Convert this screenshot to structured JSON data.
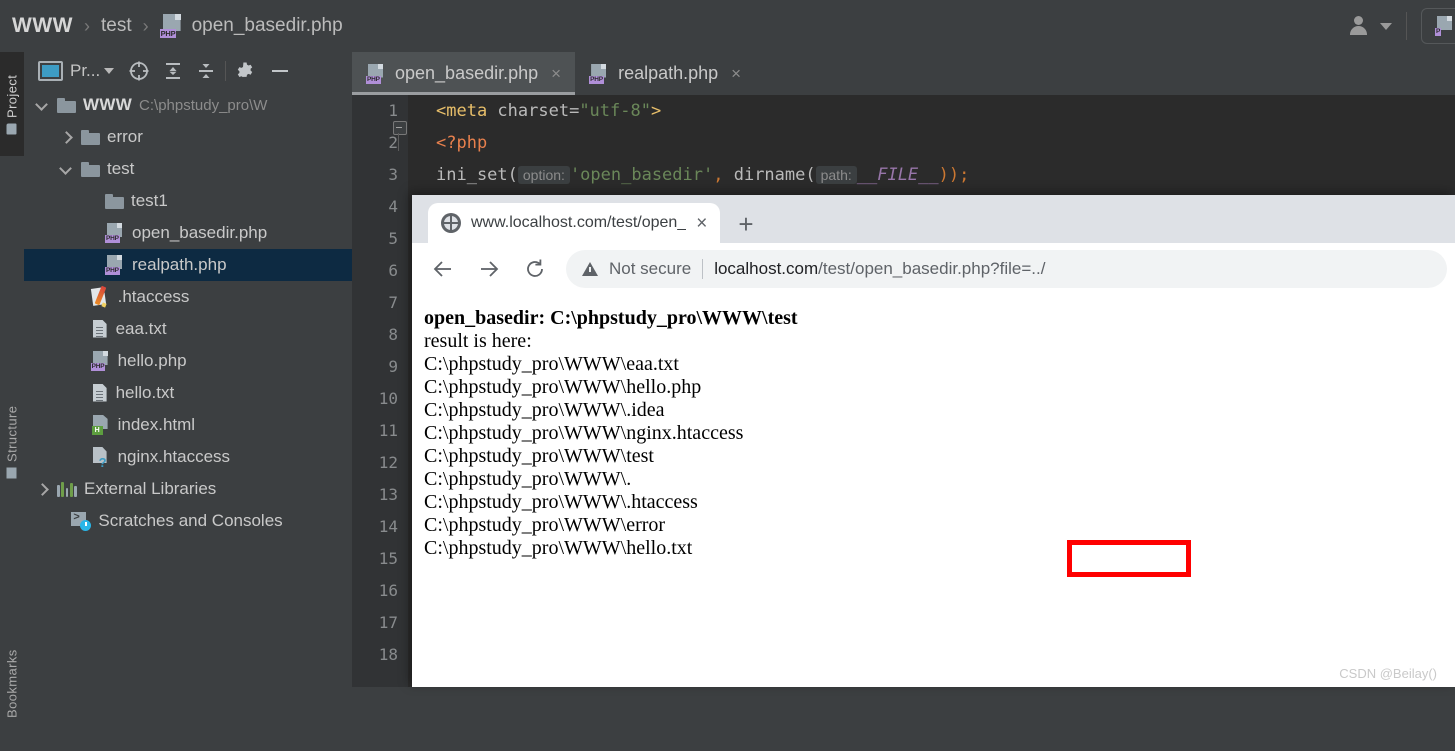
{
  "breadcrumb": {
    "root": "WWW",
    "sep": "›",
    "folder": "test",
    "file": "open_basedir.php",
    "file_icon": "php-file-icon"
  },
  "topbar": {
    "account_icon": "user-account-icon",
    "account_caret": "chevron-down-icon",
    "run_config_icon": "php-run-config-icon"
  },
  "rail": {
    "project": "Project",
    "structure": "Structure",
    "bookmarks": "Bookmarks"
  },
  "panel": {
    "title": "Pr...",
    "title_caret": "chevron-down-icon",
    "icons": [
      "select-opened-file-icon",
      "expand-all-icon",
      "collapse-all-icon",
      "settings-gear-icon",
      "hide-panel-icon"
    ]
  },
  "tree": [
    {
      "label": "WWW",
      "path": "C:\\phpstudy_pro\\W",
      "icon": "folder-icon",
      "arrow": "open",
      "indent": 0,
      "bold": true,
      "selected": false
    },
    {
      "label": "error",
      "path": "",
      "icon": "folder-icon",
      "arrow": "closed",
      "indent": 1,
      "bold": false,
      "selected": false
    },
    {
      "label": "test",
      "path": "",
      "icon": "folder-icon",
      "arrow": "open",
      "indent": 1,
      "bold": false,
      "selected": false
    },
    {
      "label": "test1",
      "path": "",
      "icon": "folder-icon",
      "arrow": "none",
      "indent": 2,
      "bold": false,
      "selected": false
    },
    {
      "label": "open_basedir.php",
      "path": "",
      "icon": "php-file-icon",
      "arrow": "none",
      "indent": 2,
      "bold": false,
      "selected": false
    },
    {
      "label": "realpath.php",
      "path": "",
      "icon": "php-file-icon",
      "arrow": "none",
      "indent": 2,
      "bold": false,
      "selected": true
    },
    {
      "label": ".htaccess",
      "path": "",
      "icon": "htaccess-file-icon",
      "arrow": "none",
      "indent": 1.4,
      "bold": false,
      "selected": false
    },
    {
      "label": "eaa.txt",
      "path": "",
      "icon": "text-file-icon",
      "arrow": "none",
      "indent": 1.4,
      "bold": false,
      "selected": false
    },
    {
      "label": "hello.php",
      "path": "",
      "icon": "php-file-icon",
      "arrow": "none",
      "indent": 1.4,
      "bold": false,
      "selected": false
    },
    {
      "label": "hello.txt",
      "path": "",
      "icon": "text-file-icon",
      "arrow": "none",
      "indent": 1.4,
      "bold": false,
      "selected": false
    },
    {
      "label": "index.html",
      "path": "",
      "icon": "html-file-icon",
      "arrow": "none",
      "indent": 1.4,
      "bold": false,
      "selected": false
    },
    {
      "label": "nginx.htaccess",
      "path": "",
      "icon": "unknown-file-icon",
      "arrow": "none",
      "indent": 1.4,
      "bold": false,
      "selected": false
    },
    {
      "label": "External Libraries",
      "path": "",
      "icon": "external-libraries-icon",
      "arrow": "closed",
      "indent": 0,
      "bold": false,
      "selected": false
    },
    {
      "label": "Scratches and Consoles",
      "path": "",
      "icon": "scratches-icon",
      "arrow": "none",
      "indent": 0.6,
      "bold": false,
      "selected": false
    }
  ],
  "editor": {
    "tabs": [
      {
        "label": "open_basedir.php",
        "icon": "php-file-icon",
        "close": "×",
        "active": true
      },
      {
        "label": "realpath.php",
        "icon": "php-file-icon",
        "close": "×",
        "active": false
      }
    ],
    "line_numbers": [
      "1",
      "2",
      "3",
      "4",
      "5",
      "6",
      "7",
      "8",
      "9",
      "10",
      "11",
      "12",
      "13",
      "14",
      "15",
      "16",
      "17",
      "18"
    ],
    "code": {
      "l1_tag_open": "<meta ",
      "l1_attr": "charset=",
      "l1_str": "\"utf-8\"",
      "l1_tag_close": ">",
      "l2": "<?php",
      "l3_fn": "ini_set(",
      "l3_hint1": "option:",
      "l3_str": "'open_basedir'",
      "l3_comma": ",",
      "l3_fn2": " dirname(",
      "l3_hint2": "path:",
      "l3_const": "__FILE__",
      "l3_tail": "));"
    }
  },
  "browser": {
    "tab_title": "www.localhost.com/test/open_",
    "tab_favicon": "globe-icon",
    "tab_close": "×",
    "new_tab": "+",
    "back_icon": "arrow-left-icon",
    "forward_icon": "arrow-right-icon",
    "reload_icon": "reload-icon",
    "security_icon": "not-secure-warning-icon",
    "security_label": "Not secure",
    "url_host": "localhost.com",
    "url_path": "/test/open_basedir.php?file=../"
  },
  "page_output": {
    "heading": "open_basedir: C:\\phpstudy_pro\\WWW\\test",
    "subtitle": "result is here:",
    "lines": [
      "C:\\phpstudy_pro\\WWW\\eaa.txt",
      "C:\\phpstudy_pro\\WWW\\hello.php",
      "C:\\phpstudy_pro\\WWW\\.idea",
      "C:\\phpstudy_pro\\WWW\\nginx.htaccess",
      "C:\\phpstudy_pro\\WWW\\test",
      "C:\\phpstudy_pro\\WWW\\.",
      "C:\\phpstudy_pro\\WWW\\.htaccess",
      "C:\\phpstudy_pro\\WWW\\error",
      "C:\\phpstudy_pro\\WWW\\hello.txt"
    ],
    "annotations": [
      {
        "name": "eaa-txt-highlight",
        "color": "#ff0000"
      },
      {
        "name": "error-dir-highlight",
        "color": "#ff0000"
      }
    ]
  },
  "watermark": "CSDN @Beilay()",
  "colors": {
    "ide_bg": "#3c3f41",
    "editor_bg": "#2b2b2b",
    "selection": "#0d2a42",
    "accent_red": "#ff0000",
    "php_badge": "#b08fd8"
  }
}
